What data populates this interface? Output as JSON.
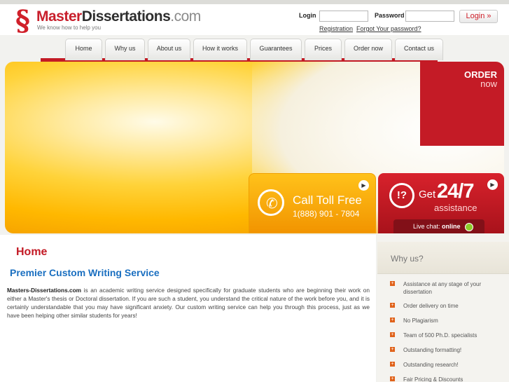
{
  "logo": {
    "mark": "§",
    "name_master": "Master",
    "name_dissertations": "Dissertations",
    "name_tld": ".com",
    "tagline": "We know how to help you"
  },
  "login": {
    "login_label": "Login",
    "password_label": "Password",
    "login_value": "",
    "password_value": "",
    "button_label": "Login »",
    "registration_link": "Registration",
    "forgot_link": "Forgot Your password?"
  },
  "nav": {
    "items": [
      {
        "label": "Home"
      },
      {
        "label": "Why us"
      },
      {
        "label": "About us"
      },
      {
        "label": "How it works"
      },
      {
        "label": "Guarantees"
      },
      {
        "label": "Prices"
      },
      {
        "label": "Order now"
      },
      {
        "label": "Contact us"
      }
    ]
  },
  "banner": {
    "order_label": "ORDER",
    "order_now": "now",
    "call_title": "Call Toll Free",
    "call_number": "1(888) 901 - 7804",
    "help_icon_text": "!?",
    "help_get": "Get",
    "help_247": "24/7",
    "help_assistance": "assistance",
    "live_chat_label": "Live chat:",
    "live_chat_status": "online"
  },
  "content": {
    "title": "Home",
    "subtitle": "Premier Custom Writing Service",
    "body_site": "Masters-Dissertations.com",
    "body_text": " is an academic writing service designed specifically for graduate students who are beginning their work on either a Master's thesis or Doctoral dissertation.  If you are such a student, you understand the critical nature of the work before you, and it is certainly understandable that you may have significant anxiety.  Our custom writing service can help you through this process, just as we have been helping other similar students for years!"
  },
  "sidebar": {
    "title": "Why us?",
    "items": [
      {
        "label": "Assistance at any stage of your dissertation"
      },
      {
        "label": "Order delivery on time"
      },
      {
        "label": "No Plagiarism"
      },
      {
        "label": "Team of 500 Ph.D. specialists"
      },
      {
        "label": "Outstanding formatting!"
      },
      {
        "label": "Outstanding research!"
      },
      {
        "label": "Fair Pricing & Discounts"
      }
    ]
  },
  "colors": {
    "brand_red": "#c31a25",
    "accent_orange": "#f29400",
    "link_blue": "#1a6fc0"
  }
}
